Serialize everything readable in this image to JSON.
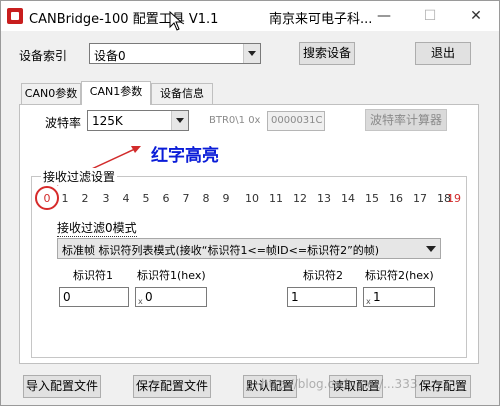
{
  "window": {
    "title": "CANBridge-100 配置工具 V1.1",
    "company": "南京来可电子科...",
    "minimize_glyph": "—",
    "maximize_glyph": "☐",
    "close_glyph": "✕"
  },
  "top": {
    "device_index_label": "设备索引",
    "device_index_value": "设备0",
    "search_button": "搜索设备",
    "exit_button": "退出"
  },
  "tabs": [
    {
      "label": "CAN0参数",
      "active": false
    },
    {
      "label": "CAN1参数",
      "active": true
    },
    {
      "label": "设备信息",
      "active": false
    }
  ],
  "can1": {
    "baud_label": "波特率",
    "baud_value": "125K",
    "btr_label": "BTR0\\1 0x",
    "btr_value": "0000031C",
    "baud_calc_button": "波特率计算器"
  },
  "annotation": {
    "text": "红字高亮",
    "color": "#0a1cd8"
  },
  "filter": {
    "group_title": "接收过滤设置",
    "indices": [
      "0",
      "1",
      "2",
      "3",
      "4",
      "5",
      "6",
      "7",
      "8",
      "9",
      "10",
      "11",
      "12",
      "13",
      "14",
      "15",
      "16",
      "17",
      "18",
      "19"
    ],
    "selected_index": "0",
    "highlight_color": "#d22b2b",
    "mode_label": "接收过滤0模式",
    "mode_value": "标准帧 标识符列表模式(接收“标识符1<=帧ID<=标识符2”的帧)",
    "id1_label": "标识符1",
    "id1_hex_label": "标识符1(hex)",
    "id2_label": "标识符2",
    "id2_hex_label": "标识符2(hex)",
    "id1_value": "0",
    "id1_hex_value": "0",
    "id2_value": "1",
    "id2_hex_value": "1",
    "hex_prefix_mark": "x"
  },
  "bottom": {
    "import_button": "导入配置文件",
    "save_file_button": "保存配置文件",
    "default_button": "默认配置",
    "read_button": "读取配置",
    "save_button": "保存配置"
  },
  "watermark": "http://blog.csdn.net/...333"
}
